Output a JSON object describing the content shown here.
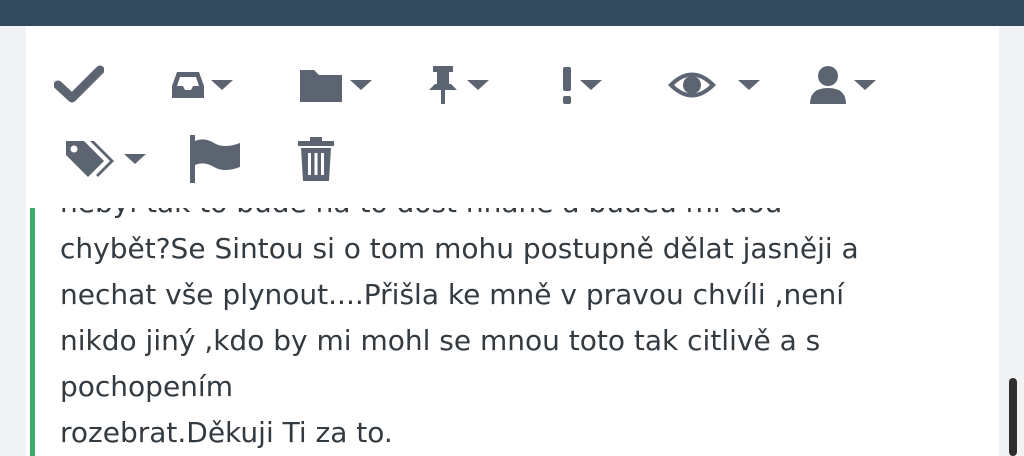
{
  "toolbar": {
    "items": [
      {
        "icon": "check-icon",
        "has_menu": false
      },
      {
        "icon": "inbox-icon",
        "has_menu": true
      },
      {
        "icon": "folder-icon",
        "has_menu": true
      },
      {
        "icon": "pin-icon",
        "has_menu": true
      },
      {
        "icon": "priority-icon",
        "has_menu": true
      },
      {
        "icon": "eye-icon",
        "has_menu": true
      },
      {
        "icon": "user-icon",
        "has_menu": true
      },
      {
        "icon": "tags-icon",
        "has_menu": true
      },
      {
        "icon": "flag-icon",
        "has_menu": false
      },
      {
        "icon": "trash-icon",
        "has_menu": false
      }
    ],
    "icon_color": "#5b6470"
  },
  "message": {
    "lines": [
      "nebyl tak to bude na to dost hnaně a budeu mi dou",
      "chybět?Se Sintou si o tom mohu postupně dělat jasněji a",
      "nechat vše plynout....Přišla ke mně v pravou chvíli ,není",
      "nikdo jiný ,kdo by mi  mohl se mnou toto tak citlivě a s",
      "pochopením",
      "rozebrat.Děkuji Ti za to."
    ],
    "accent_color": "#3daa6b"
  },
  "colors": {
    "header": "#334a5e",
    "background": "#f1f2f4",
    "text": "#333a40"
  }
}
